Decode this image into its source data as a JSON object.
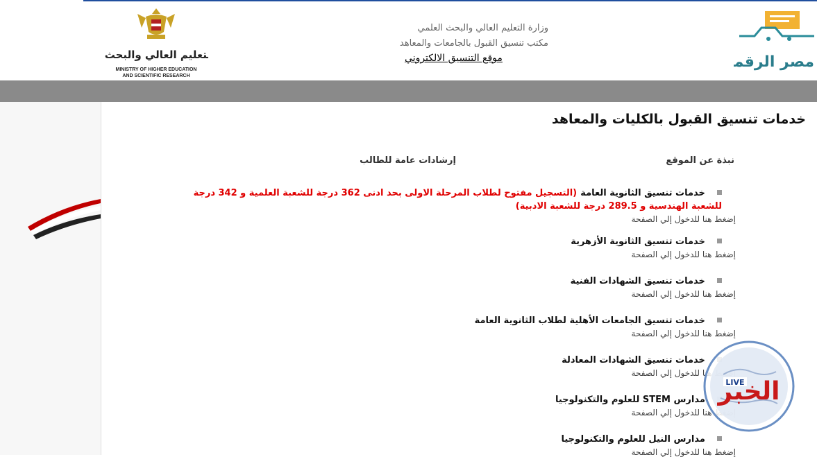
{
  "header": {
    "ministry_line1": "وزارة التعليم العالي والبحث العلمي",
    "ministry_line2": "مكتب تنسيق القبول بالجامعات والمعاهد",
    "site_link": "موقع التنسيق الالكتروني",
    "left_logo_ar": "وزارة التعليم العالي والبحث العلمي",
    "left_logo_en1": "MINISTRY OF HIGHER EDUCATION",
    "left_logo_en2": "AND SCIENTIFIC RESEARCH",
    "right_logo_text": "مصر الرقمية"
  },
  "main": {
    "title": "خدمات تنسيق القبول بالكليات والمعاهد",
    "tabs": [
      {
        "label": "نبذة عن الموقع"
      },
      {
        "label": "إرشادات عامة للطالب"
      }
    ],
    "items": [
      {
        "title": "خدمات تنسيق الثانوية العامة",
        "note": "(التسجيل مفتوح لطلاب المرحلة الاولى بحد ادنى 362 درجة للشعبة العلمية و 342 درجة للشعبة الهندسية و 289.5 درجة للشعبة الادبية)",
        "link": "إضغط هنا للدخول إلي الصفحة"
      },
      {
        "title": "خدمات تنسيق الثانوية الأزهرية",
        "link": "إضغط هنا للدخول إلي الصفحة"
      },
      {
        "title": "خدمات تنسيق الشهادات الفنية",
        "link": "إضغط هنا للدخول إلي الصفحة"
      },
      {
        "title": "خدمات تنسيق الجامعات الأهلية لطلاب الثانوية العامة",
        "link": "إضغط هنا للدخول إلي الصفحة"
      },
      {
        "title": "خدمات تنسيق الشهادات المعادلة",
        "link": "إضغط هنا للدخول إلي الصفحة"
      },
      {
        "title": "مدارس STEM للعلوم والتكنولوجيا",
        "link": "إضغط هنا للدخول إلي الصفحة"
      },
      {
        "title": "مدارس النيل للعلوم والتكنولوجيا",
        "link": "إضغط هنا للدخول إلي الصفحة"
      }
    ]
  },
  "watermark": {
    "text_ar": "الخبر",
    "text_en": "LIVE"
  }
}
